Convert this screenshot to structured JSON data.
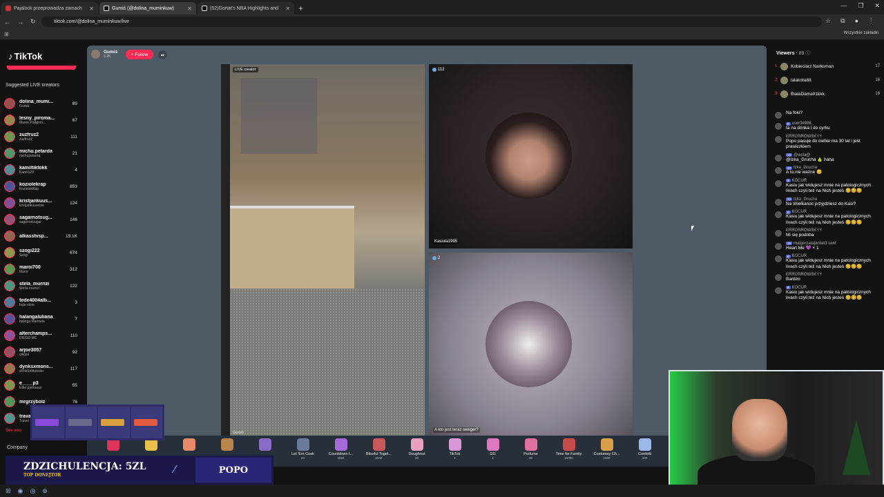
{
  "browser": {
    "tabs": [
      {
        "title": "Pajalock przeprowadza zamach",
        "active": false,
        "favcolor": "#c33"
      },
      {
        "title": "Gumiś (@dolina_muminkuw)",
        "active": true,
        "favcolor": "#fff"
      },
      {
        "title": "(62)Gortat's NBA Highlights and",
        "active": false,
        "favcolor": "#fff"
      }
    ],
    "url": "tiktok.com/@dolina_muminkuw/live",
    "all_bookmarks": "Wszystkie zakładki"
  },
  "sidebar": {
    "logo": "TikTok",
    "suggested_title": "Suggested LIVE creators",
    "creators": [
      {
        "name": "dolina_mumi...",
        "sub": "Gumiś",
        "count": "89"
      },
      {
        "name": "lesny_piroma...",
        "sub": "Marek Podgórn...",
        "count": "67"
      },
      {
        "name": "zuzfruz2",
        "sub": "zuzfruz2",
        "count": "111"
      },
      {
        "name": "michu.petarda",
        "sub": "michupetarda",
        "count": "21"
      },
      {
        "name": "kamiltiktokk",
        "sub": "Kamil123",
        "count": "4"
      },
      {
        "name": "koziolekrap",
        "sub": "KoziolekRap",
        "count": "853"
      },
      {
        "name": "kristjankuus...",
        "sub": "kristjankuuseste",
        "count": "124"
      },
      {
        "name": "sagarnotsug...",
        "sub": "sagarnotsugar",
        "count": "146"
      },
      {
        "name": "alkasstvsp...",
        "sub": "",
        "count": "15.1K"
      },
      {
        "name": "szogi222",
        "sub": "Szogi",
        "count": "674"
      },
      {
        "name": "maroi700",
        "sub": "Maroi",
        "count": "312"
      },
      {
        "name": "stela_murrizi",
        "sub": "Stella murrizi",
        "count": "122"
      },
      {
        "name": "fede4004alb...",
        "sub": "fede vlore",
        "count": "3"
      },
      {
        "name": "halangaluliana",
        "sub": "halinga Marinela",
        "count": "7"
      },
      {
        "name": "alterchamps...",
        "sub": "DIEGO MC",
        "count": "110"
      },
      {
        "name": "arjoe3057",
        "sub": "cArjoe",
        "count": "92"
      },
      {
        "name": "dynksxmons...",
        "sub": "dYnkSxMonster",
        "count": "117"
      },
      {
        "name": "e____p3",
        "sub": "Eder.pjetraaus",
        "count": "55"
      },
      {
        "name": "mrgrzybolz",
        "sub": "",
        "count": "76"
      },
      {
        "name": "trava",
        "sub": "Travel",
        "count": ""
      }
    ],
    "see_less": "See less",
    "company": "Company"
  },
  "stream": {
    "host_name": "Gumiś",
    "host_likes": "6.2K",
    "follow_label": "+ Follow",
    "live_badge": "LIVE creator",
    "main_corner": "Gumiś",
    "guest1_count": "112",
    "guest1_name": "Kasiula1995",
    "guest2_count": "2",
    "guest2_name": "A kto jest teraz sweger?"
  },
  "gifts": [
    {
      "name": "",
      "price": "",
      "color": "#e0345a"
    },
    {
      "name": "",
      "price": "",
      "color": "#e8c04a"
    },
    {
      "name": "",
      "price": "",
      "color": "#e88a6a"
    },
    {
      "name": "",
      "price": "",
      "color": "#b8864a"
    },
    {
      "name": "",
      "price": "",
      "color": "#8a6ac8"
    },
    {
      "name": "Let 'Em Cook",
      "price": "20",
      "color": "#6a7a9a"
    },
    {
      "name": "Countdown t...",
      "price": "2026",
      "color": "#a46ad8"
    },
    {
      "name": "Blissful Toget...",
      "price": "6202",
      "color": "#c8585a"
    },
    {
      "name": "Doughnut",
      "price": "30",
      "color": "#e8a0c0"
    },
    {
      "name": "TikTok",
      "price": "1",
      "color": "#d898d8"
    },
    {
      "name": "GG",
      "price": "1",
      "color": "#e078c0"
    },
    {
      "name": "Perfume",
      "price": "20",
      "color": "#e070a0"
    },
    {
      "name": "Time for Family",
      "price": "15000",
      "color": "#c84a4a"
    },
    {
      "name": "Costumey Ch...",
      "price": "1500",
      "color": "#d8a04a"
    },
    {
      "name": "Confetti",
      "price": "100",
      "color": "#9ab8e8"
    }
  ],
  "viewers": {
    "title": "Viewers",
    "count": "89",
    "list": [
      {
        "rank": "1",
        "name": "Kobieciarz Narkoman",
        "score": "17"
      },
      {
        "rank": "2",
        "name": "lalakota88",
        "score": "16"
      },
      {
        "rank": "3",
        "name": "BiałaDama91kkk",
        "score": "16"
      }
    ]
  },
  "chat": [
    {
      "user": "",
      "text": "Na foki?",
      "lvl": ""
    },
    {
      "user": "user34986",
      "text": "ta na drinka i do cyrku",
      "lvl": "5"
    },
    {
      "user": "ERRORROWSKYY",
      "text": "Popo pasuje do ciebie ma 30 lat i jest prawiczkiem",
      "lvl": ""
    },
    {
      "user": "@wcia@",
      "text": "@Izka_Grucha 🍐 haha",
      "lvl": "16"
    },
    {
      "user": "Izka_Grucha",
      "text": "A to nie ważne 😊",
      "lvl": "13"
    },
    {
      "user": "KOCUR",
      "text": "Kasiu jak widujesz mnie na patologicznych livach czyli też na Nich jesteś 🥴🥴🥴",
      "lvl": "6"
    },
    {
      "user": "Izka_Grucha",
      "text": "Na Wielkanoc przyjdziesz do Kasi?",
      "lvl": "13"
    },
    {
      "user": "KOCUR",
      "text": "Kasiu jak widujesz mnie na patologicznych livach czyli też na Nich jesteś 🥴🥴🥴",
      "lvl": "6"
    },
    {
      "user": "ERRORROWSKYY",
      "text": "Mi się podoba",
      "lvl": ""
    },
    {
      "user": "malgorzatajaniak3 sent",
      "text": "Heart Me 💜 × 1",
      "lvl": "19"
    },
    {
      "user": "KOCUR",
      "text": "Kasiu jak widujesz mnie na patologicznych livach czyli też na Nich jesteś 🥴🥴🥴",
      "lvl": "6"
    },
    {
      "user": "ERRORROWSKYY",
      "text": "Bardzo",
      "lvl": ""
    },
    {
      "user": "KOCUR",
      "text": "Kasiu jak widujesz mnie na patologicznych livach czyli też na Nich jesteś 🥴🥴🥴",
      "lvl": "6"
    }
  ],
  "overlay": {
    "donation_title": "ZDZICHULENCJA: 5ZL",
    "donation_sub": "TOP DONEJTOR",
    "donation_box": "POPO",
    "skin_labels": [
      "",
      "",
      "",
      ""
    ]
  },
  "colors": {
    "accent": "#fe2c55",
    "page_bg": "#121212",
    "stream_bg": "#4f5a67"
  }
}
